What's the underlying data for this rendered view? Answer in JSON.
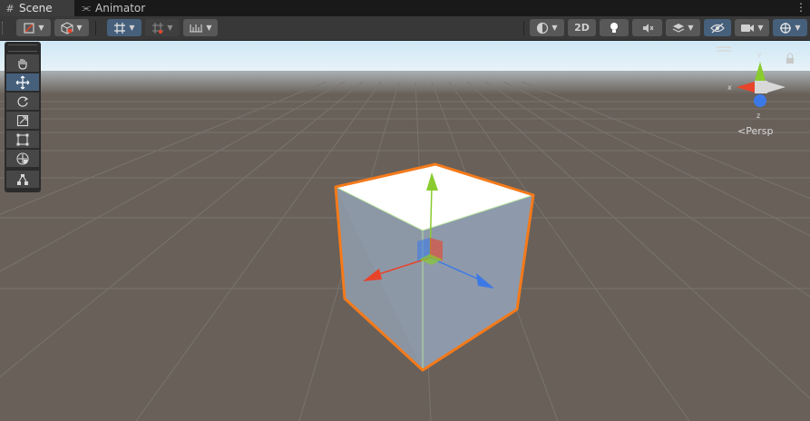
{
  "tabs": [
    {
      "label": "Scene",
      "icon": "grid-icon",
      "active": true
    },
    {
      "label": "Animator",
      "icon": "animator-icon",
      "active": false
    }
  ],
  "tab_menu_icon": "kebab-menu-icon",
  "toolbar": {
    "left_buttons": [
      {
        "icon": "draw-mode-icon",
        "dropdown": true
      },
      {
        "icon": "cube-icon",
        "dropdown": true
      },
      {
        "icon": "grid-snap-icon",
        "dropdown": true,
        "active": true
      },
      {
        "icon": "increment-snap-icon",
        "dropdown": true
      },
      {
        "icon": "ruler-icon",
        "dropdown": true
      }
    ],
    "right_buttons": [
      {
        "icon": "shading-mode-icon",
        "dropdown": true
      },
      {
        "label": "2D"
      },
      {
        "icon": "lightbulb-icon"
      },
      {
        "icon": "audio-mute-icon"
      },
      {
        "icon": "effects-layers-icon",
        "dropdown": true
      },
      {
        "icon": "visibility-icon",
        "active": true
      },
      {
        "icon": "camera-icon",
        "dropdown": true
      },
      {
        "icon": "gizmos-icon",
        "dropdown": true,
        "active": true
      }
    ]
  },
  "tools": [
    {
      "name": "hand-tool",
      "icon": "hand-icon",
      "active": false
    },
    {
      "name": "move-tool",
      "icon": "move-icon",
      "active": true
    },
    {
      "name": "rotate-tool",
      "icon": "rotate-icon",
      "active": false
    },
    {
      "name": "scale-tool",
      "icon": "scale-icon",
      "active": false
    },
    {
      "name": "rect-tool",
      "icon": "rect-icon",
      "active": false
    },
    {
      "name": "transform-tool",
      "icon": "transform-icon",
      "active": false
    },
    {
      "name": "custom-tool",
      "icon": "custom-tool-icon",
      "active": false
    }
  ],
  "orientation_gizmo": {
    "axes": {
      "x": "x",
      "y": "y",
      "z": "z"
    },
    "projection_label": "Persp"
  },
  "colors": {
    "x_axis": "#e8442a",
    "y_axis": "#8acb2f",
    "z_axis": "#3d79e6",
    "selection_outline": "#f47a1b",
    "active_tool": "#46607c",
    "ground": "#686059"
  }
}
